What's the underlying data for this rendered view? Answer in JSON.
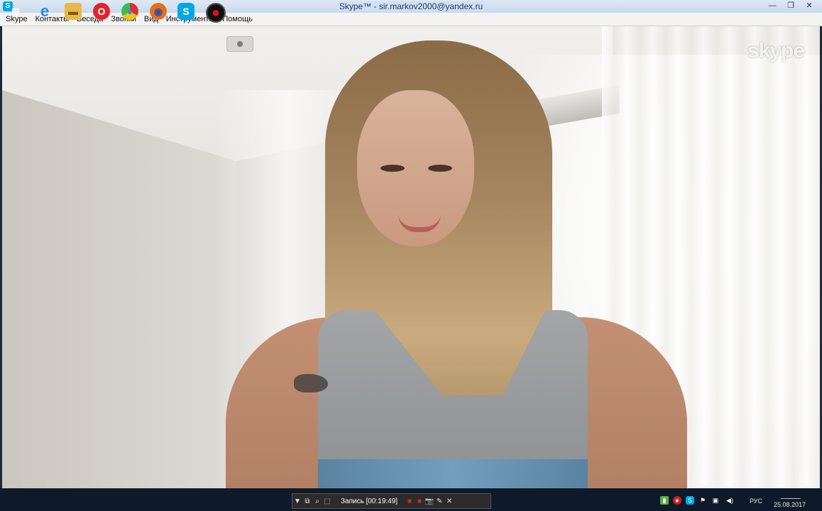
{
  "window": {
    "title": "Skype™ - sir.markov2000@yandex.ru",
    "app_icon": "S",
    "controls": [
      "—",
      "❐",
      "✕"
    ]
  },
  "menu": [
    "Skype",
    "Контакты",
    "Беседа",
    "Звонки",
    "Вид",
    "Инструменты",
    "Помощь"
  ],
  "video": {
    "watermark": "skype"
  },
  "taskbar": {
    "apps": [
      {
        "name": "windows-start",
        "glyph": "⊞",
        "color": "#ffffff"
      },
      {
        "name": "internet-explorer",
        "glyph": "e",
        "color": "#2a8de0"
      },
      {
        "name": "file-explorer",
        "glyph": "▬",
        "color": "#e8b84c"
      },
      {
        "name": "opera",
        "glyph": "O",
        "color": "#e0252b"
      },
      {
        "name": "chrome",
        "glyph": "●",
        "color": "#3aa14d"
      },
      {
        "name": "firefox",
        "glyph": "◉",
        "color": "#e76f18"
      },
      {
        "name": "skype",
        "glyph": "S",
        "color": "#00a7e7"
      },
      {
        "name": "recorder",
        "glyph": "●",
        "color": "#e21010"
      }
    ],
    "recording": {
      "label": "Запись [00:19:49]",
      "buttons": [
        "▼",
        "⧉",
        "⌕",
        "⬚",
        "■",
        "■",
        "📷",
        "✎",
        "✕"
      ]
    },
    "tray": {
      "icons": [
        "▮",
        "●",
        "S",
        "⚑",
        "▣",
        "◀)"
      ],
      "language": "РУС",
      "date": "25.08.2017"
    }
  },
  "colors": {
    "skype_blue": "#00a7e7",
    "taskbar": "#0e1a2a"
  }
}
